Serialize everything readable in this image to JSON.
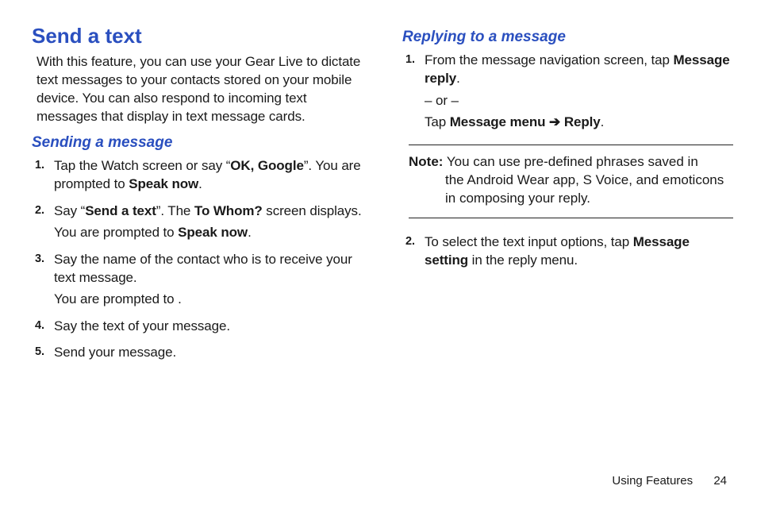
{
  "left": {
    "title": "Send a text",
    "intro": "With this feature, you can use your Gear Live to dictate text messages to your contacts stored on your mobile device. You can also respond to incoming text messages that display in text message cards.",
    "subhead": "Sending a message",
    "steps": [
      {
        "num": "1.",
        "parts": [
          {
            "t": "Tap the Watch screen or say “"
          },
          {
            "t": "OK, Google",
            "b": true
          },
          {
            "t": "”. You are prompted to "
          },
          {
            "t": "Speak now",
            "b": true
          },
          {
            "t": "."
          }
        ]
      },
      {
        "num": "2.",
        "lines": [
          [
            {
              "t": "Say “"
            },
            {
              "t": "Send a text",
              "b": true
            },
            {
              "t": "”. The "
            },
            {
              "t": "To Whom?",
              "b": true
            },
            {
              "t": " screen displays."
            }
          ],
          [
            {
              "t": "You are prompted to "
            },
            {
              "t": "Speak now",
              "b": true
            },
            {
              "t": "."
            }
          ]
        ]
      },
      {
        "num": "3.",
        "lines": [
          [
            {
              "t": "Say the name of the contact who is to receive your text message."
            }
          ],
          [
            {
              "t": "You are prompted to ."
            }
          ]
        ]
      },
      {
        "num": "4.",
        "parts": [
          {
            "t": "Say the text of your message."
          }
        ]
      },
      {
        "num": "5.",
        "parts": [
          {
            "t": "Send your message."
          }
        ]
      }
    ]
  },
  "right": {
    "subhead": "Replying to a message",
    "steps1": [
      {
        "num": "1.",
        "lines": [
          [
            {
              "t": "From the message navigation screen, tap "
            },
            {
              "t": "Message reply",
              "b": true
            },
            {
              "t": "."
            }
          ],
          [
            {
              "t": "– or –"
            }
          ],
          [
            {
              "t": "Tap "
            },
            {
              "t": "Message menu ",
              "b": true
            },
            {
              "t": "➔",
              "b": true,
              "arrow": true
            },
            {
              "t": " Reply",
              "b": true
            },
            {
              "t": "."
            }
          ]
        ]
      }
    ],
    "note": {
      "label": "Note:",
      "line1": " You can use pre-defined phrases saved in",
      "cont": "the Android Wear app, S Voice, and emoticons in composing your reply."
    },
    "steps2": [
      {
        "num": "2.",
        "parts": [
          {
            "t": "To select the text input options, tap "
          },
          {
            "t": "Message setting",
            "b": true
          },
          {
            "t": " in the reply menu."
          }
        ]
      }
    ]
  },
  "footer": {
    "section": "Using Features",
    "page": "24"
  }
}
